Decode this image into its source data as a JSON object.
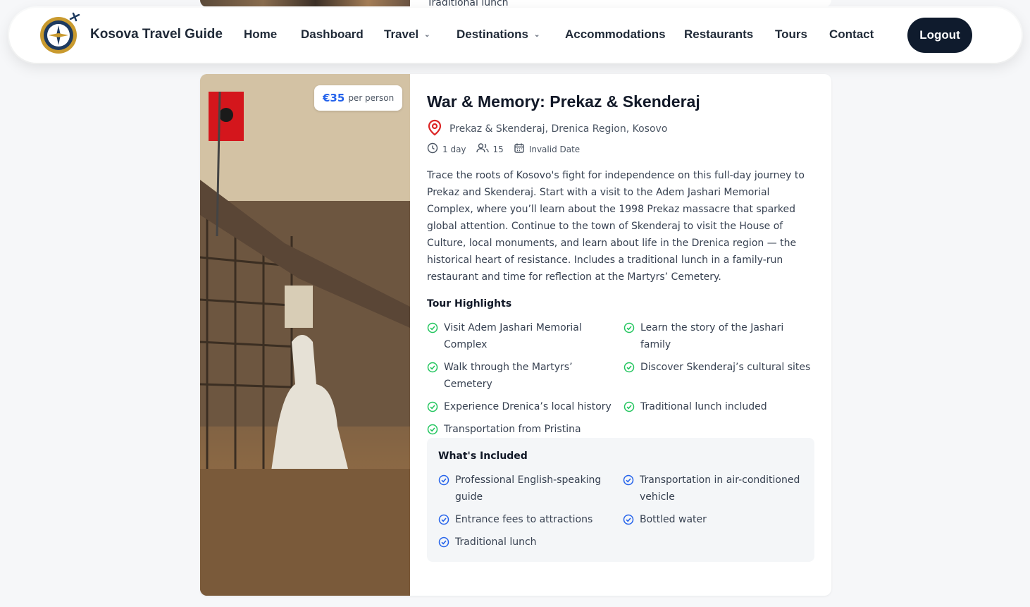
{
  "prev_card": {
    "text": "Traditional lunch"
  },
  "navbar": {
    "brand": "Kosova Travel Guide",
    "items": [
      {
        "label": "Home"
      },
      {
        "label": "Dashboard"
      },
      {
        "label": "Travel"
      },
      {
        "label": "Destinations"
      },
      {
        "label": "Accommodations"
      },
      {
        "label": "Restaurants"
      },
      {
        "label": "Tours"
      },
      {
        "label": "Contact"
      }
    ],
    "logout": "Logout"
  },
  "tour": {
    "price": "€35",
    "price_unit": "per person",
    "title": "War & Memory: Prekaz & Skenderaj",
    "location": "Prekaz & Skenderaj, Drenica Region, Kosovo",
    "duration": "1 day",
    "group_size": "15",
    "date": "Invalid Date",
    "description": "Trace the roots of Kosovo's fight for independence on this full-day journey to Prekaz and Skenderaj. Start with a visit to the Adem Jashari Memorial Complex, where you’ll learn about the 1998 Prekaz massacre that sparked global attention. Continue to the town of Skenderaj to visit the House of Culture, local monuments, and learn about life in the Drenica region — the historical heart of resistance. Includes a traditional lunch in a family-run restaurant and time for reflection at the Martyrs’ Cemetery.",
    "highlights_title": "Tour Highlights",
    "highlights": [
      "Visit Adem Jashari Memorial Complex",
      "Learn the story of the Jashari family",
      "Walk through the Martyrs’ Cemetery",
      "Discover Skenderaj’s cultural sites",
      "Experience Drenica’s local history",
      "Traditional lunch included",
      "Transportation from Pristina"
    ],
    "included_title": "What's Included",
    "included": [
      "Professional English-speaking guide",
      "Transportation in air-conditioned vehicle",
      "Entrance fees to attractions",
      "Bottled water",
      "Traditional lunch"
    ]
  },
  "colors": {
    "accent": "#2563eb",
    "check_green": "#22c55e",
    "logout_bg": "#0f1b2d",
    "pin_red": "#dc2626"
  }
}
